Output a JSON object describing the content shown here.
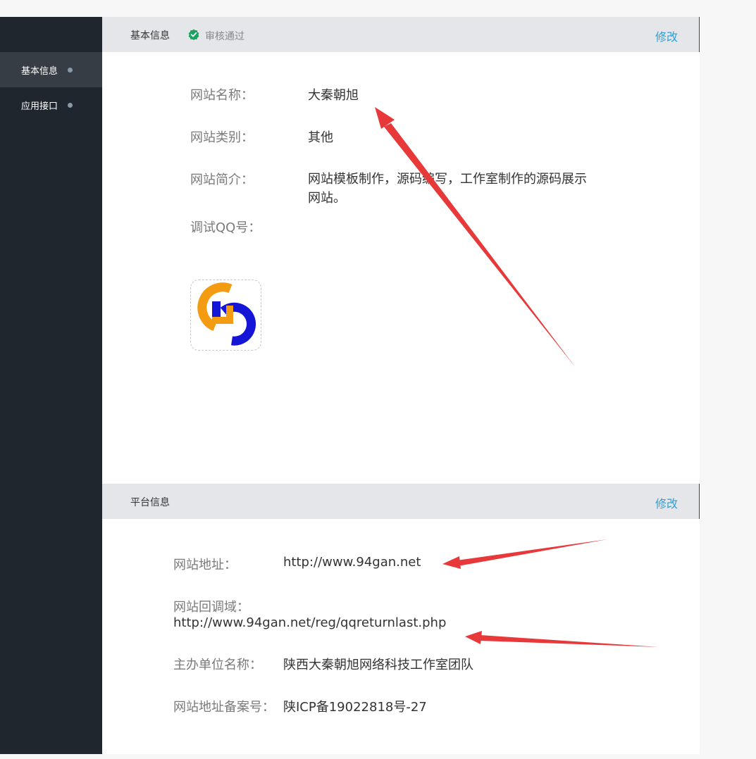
{
  "sidebar": {
    "items": [
      {
        "label": "基本信息",
        "active": true
      },
      {
        "label": "应用接口",
        "active": false
      }
    ]
  },
  "basic_info": {
    "title": "基本信息",
    "status": "审核通过",
    "status_color": "#1aa260",
    "edit_label": "修改",
    "fields": {
      "site_name_label": "网站名称：",
      "site_name_value": "大秦朝旭",
      "site_category_label": "网站类别：",
      "site_category_value": "其他",
      "site_intro_label": "网站简介：",
      "site_intro_value": "网站模板制作，源码编写，工作室制作的源码展示网站。",
      "debug_qq_label": "调试QQ号："
    },
    "logo_icon": "site-logo"
  },
  "platform_info": {
    "title": "平台信息",
    "edit_label": "修改",
    "fields": {
      "site_url_label": "网站地址：",
      "site_url_value": "http://www.94gan.net",
      "callback_label": "网站回调域：",
      "callback_value": "http://www.94gan.net/reg/qqreturnlast.php",
      "organizer_label": "主办单位名称：",
      "organizer_value": "陕西大秦朝旭网络科技工作室团队",
      "icp_label": "网站地址备案号：",
      "icp_value": "陕ICP备19022818号-27"
    }
  },
  "colors": {
    "sidebar_bg": "#1f262e",
    "sidebar_active_bg": "#363d44",
    "header_bg": "#e5e6e9",
    "link": "#2f9fd6",
    "annotation_arrow": "#e8393a"
  }
}
